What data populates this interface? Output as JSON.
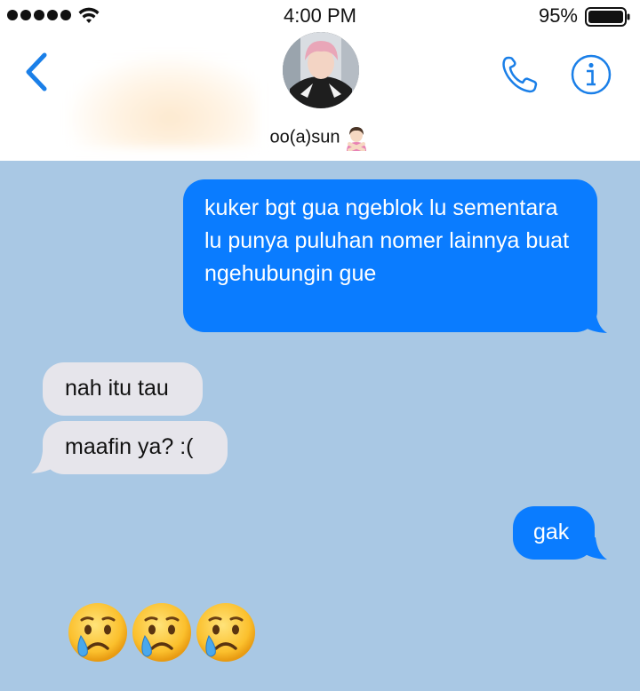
{
  "status_bar": {
    "time": "4:00 PM",
    "battery_percent": "95%",
    "signal_bars": 5,
    "icons": [
      "signal-dots-icon",
      "wifi-icon",
      "battery-icon"
    ]
  },
  "header": {
    "contact_name": "oo(a)sun",
    "icons": [
      "back-chevron-icon",
      "phone-icon",
      "info-icon",
      "person-gesturing-no-emoji"
    ]
  },
  "messages": [
    {
      "direction": "sent",
      "text": "kuker bgt gua ngeblok lu sementara lu punya puluhan nomer lainnya buat ngehubungin gue"
    },
    {
      "direction": "received",
      "text": "nah itu tau"
    },
    {
      "direction": "received",
      "text": "maafin ya? :("
    },
    {
      "direction": "sent",
      "text": "gak"
    }
  ],
  "reaction_emoji": {
    "name": "crying-face-emoji",
    "count": 3
  },
  "colors": {
    "chat_background": "#a9c8e4",
    "sent_bubble": "#0a7cff",
    "received_bubble": "#e6e5eb",
    "accent": "#1a7fe8"
  }
}
